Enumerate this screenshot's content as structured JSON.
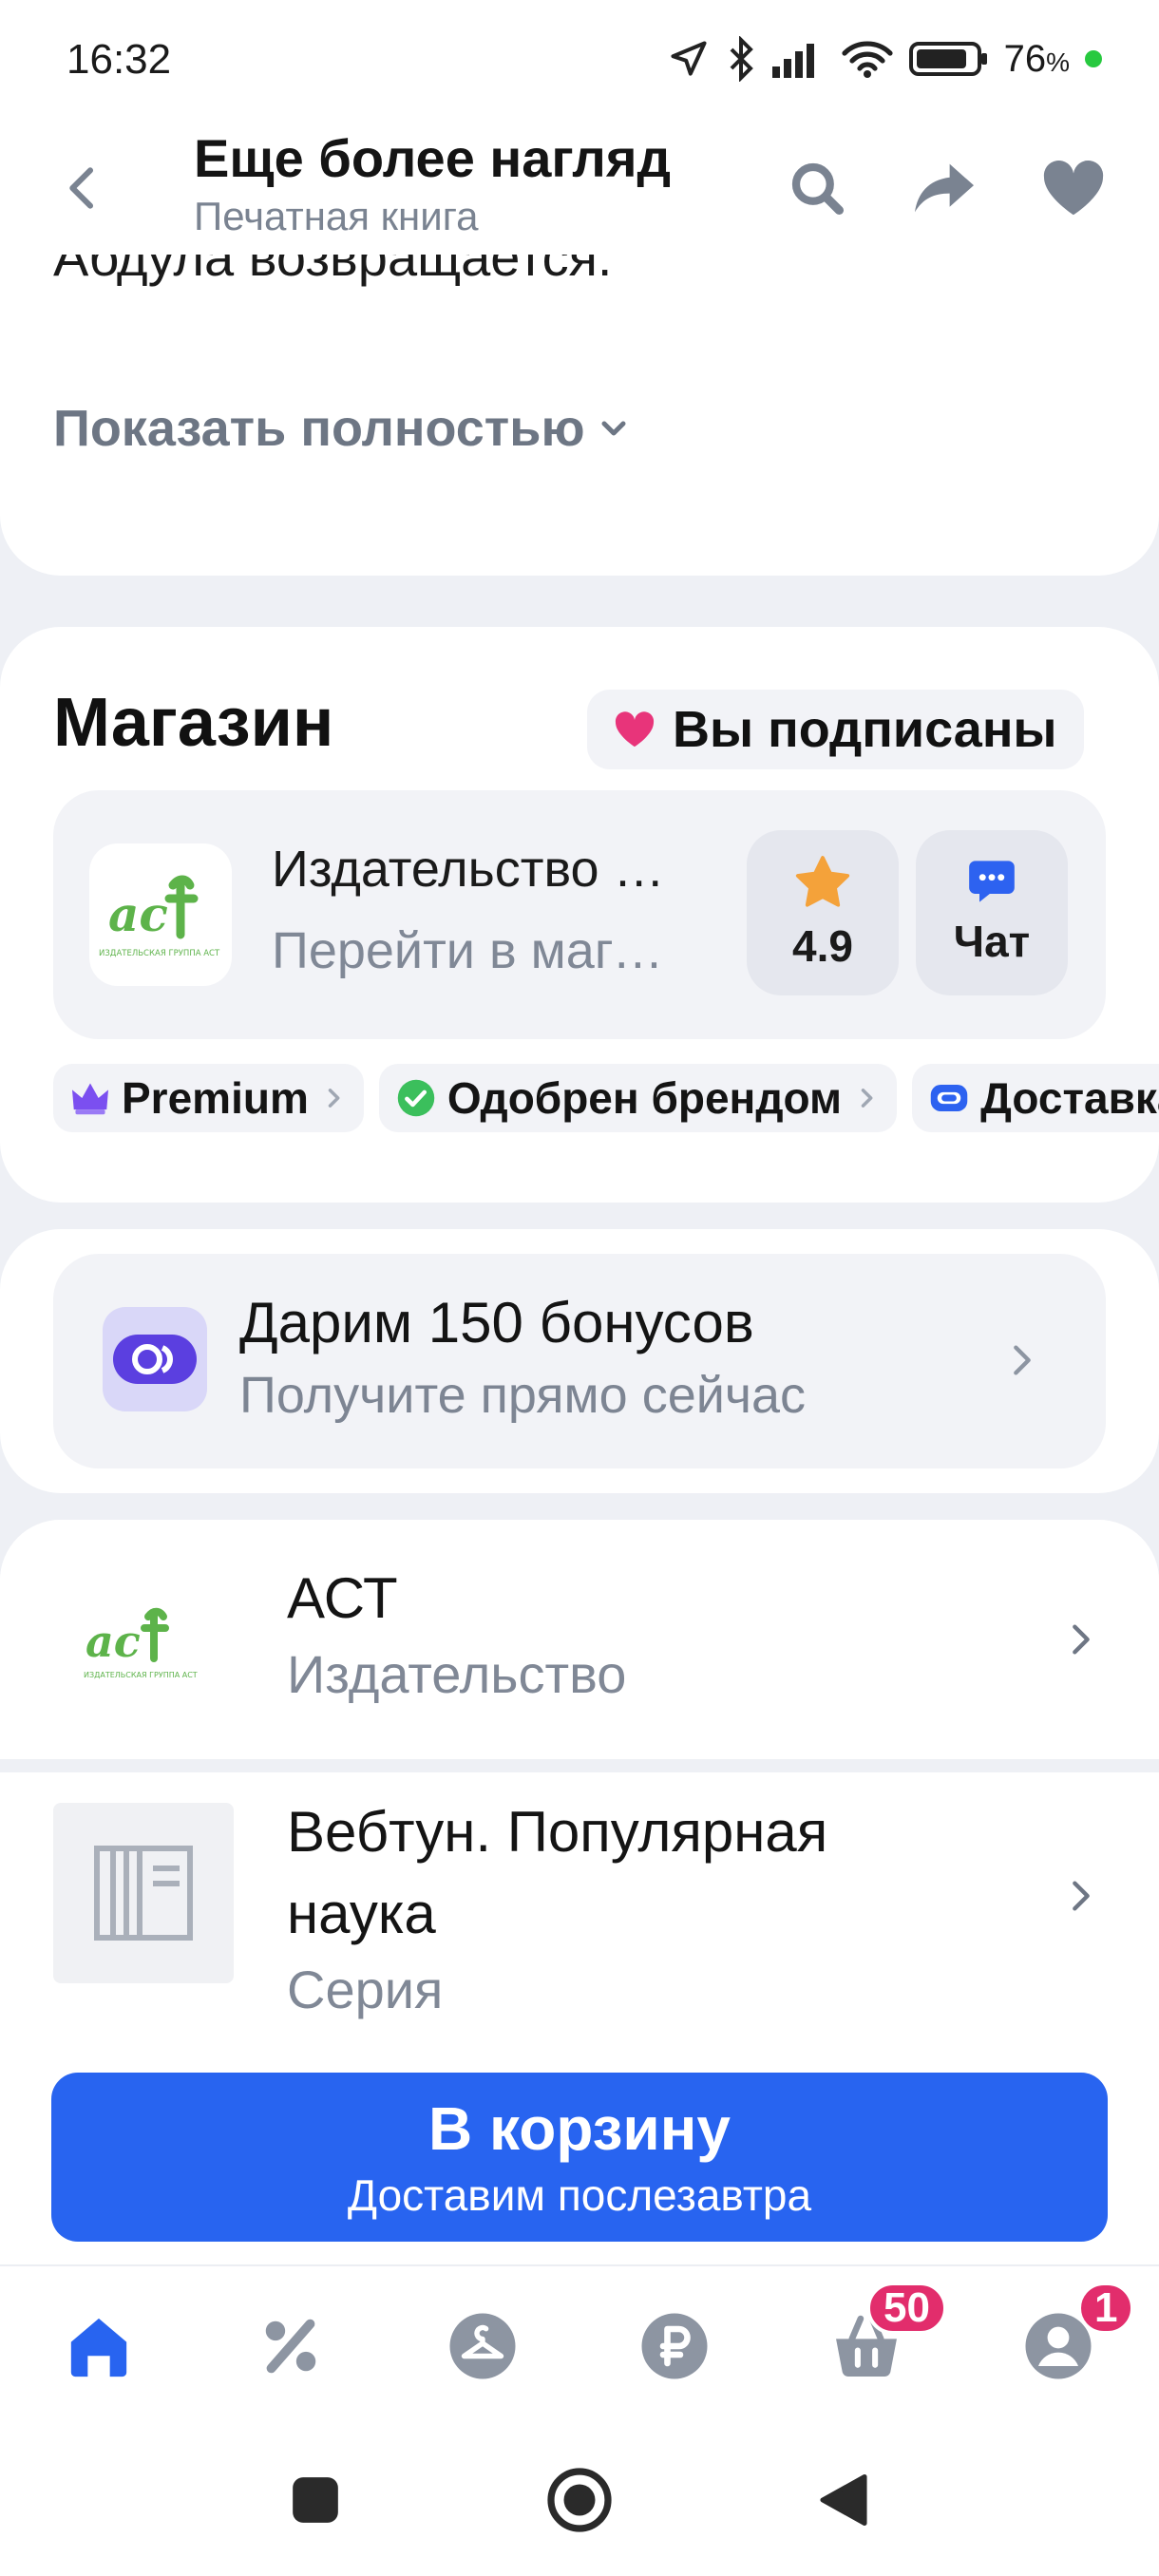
{
  "status_bar": {
    "time": "16:32",
    "battery_percent": "76",
    "battery_suffix": "%"
  },
  "header": {
    "title": "Еще более нагляд",
    "subtitle": "Печатная книга"
  },
  "description": {
    "cut_text": "Абдула возвращается.",
    "show_full": "Показать полностью"
  },
  "store": {
    "title": "Магазин",
    "subscribed": "Вы подписаны",
    "seller_name": "Издательство АСТ",
    "seller_link": "Перейти в магазин",
    "logo_text": "ИЗДАТЕЛЬСКАЯ ГРУППА АСТ",
    "rating": "4.9",
    "chat": "Чат",
    "badges": [
      {
        "label": "Premium"
      },
      {
        "label": "Одобрен брендом"
      },
      {
        "label": "Доставка"
      }
    ]
  },
  "bonus": {
    "title": "Дарим 150 бонусов",
    "subtitle": "Получите прямо сейчас"
  },
  "list": [
    {
      "title": "АСТ",
      "subtitle": "Издательство"
    },
    {
      "title": "Вебтун. Популярная наука",
      "subtitle": "Серия"
    }
  ],
  "cart": {
    "label": "В корзину",
    "delivery": "Доставим послезавтра"
  },
  "tabbar": {
    "cart_count": "50",
    "profile_count": "1"
  },
  "colors": {
    "accent": "#2864f0",
    "badge": "#e22d6c",
    "heart": "#e8347a"
  }
}
